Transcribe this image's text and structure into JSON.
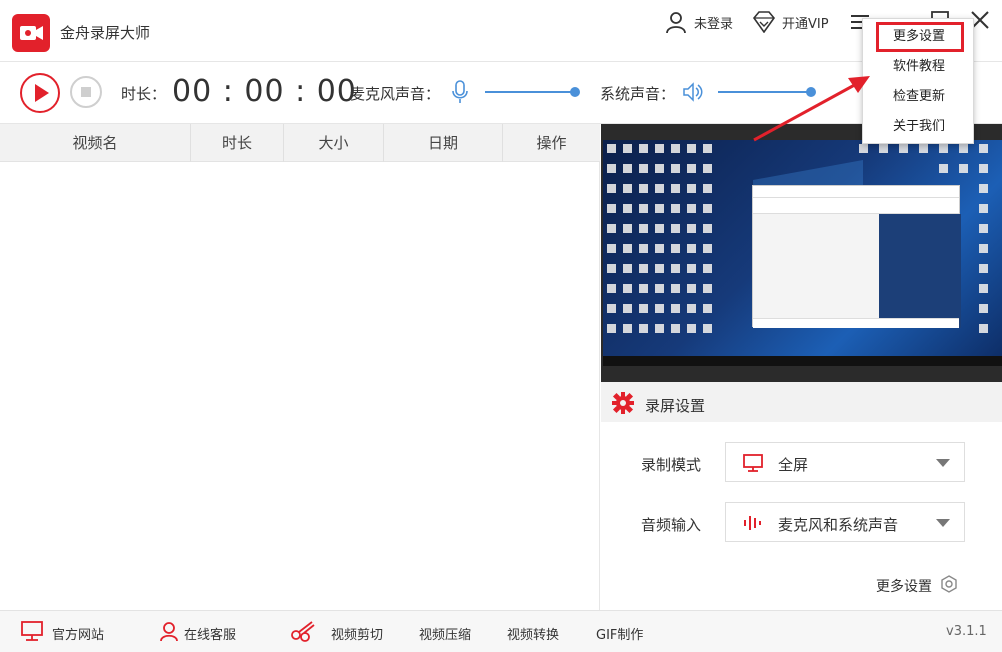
{
  "app": {
    "title": "金舟录屏大师",
    "version": "v3.1.1"
  },
  "titlebar": {
    "login_label": "未登录",
    "vip_label": "开通VIP"
  },
  "recorder": {
    "duration_label": "时长：",
    "duration_value": "00 : 00 : 00",
    "mic_label": "麦克风声音：",
    "mic_level": 0.9,
    "system_sound_label": "系统声音：",
    "system_sound_level": 0.9
  },
  "table": {
    "columns": [
      "视频名",
      "时长",
      "大小",
      "日期",
      "操作"
    ],
    "rows": []
  },
  "settings": {
    "title": "录屏设置",
    "record_mode_label": "录制模式",
    "record_mode_value": "全屏",
    "audio_input_label": "音频输入",
    "audio_input_value": "麦克风和系统声音",
    "more_label": "更多设置"
  },
  "menu": {
    "items": [
      "更多设置",
      "软件教程",
      "检查更新",
      "关于我们"
    ],
    "highlighted": 0
  },
  "footer": {
    "items": [
      "官方网站",
      "在线客服",
      "视频剪切",
      "视频压缩",
      "视频转换",
      "GIF制作"
    ]
  },
  "colors": {
    "accent": "#e2212b",
    "slider": "#4a90d9"
  }
}
